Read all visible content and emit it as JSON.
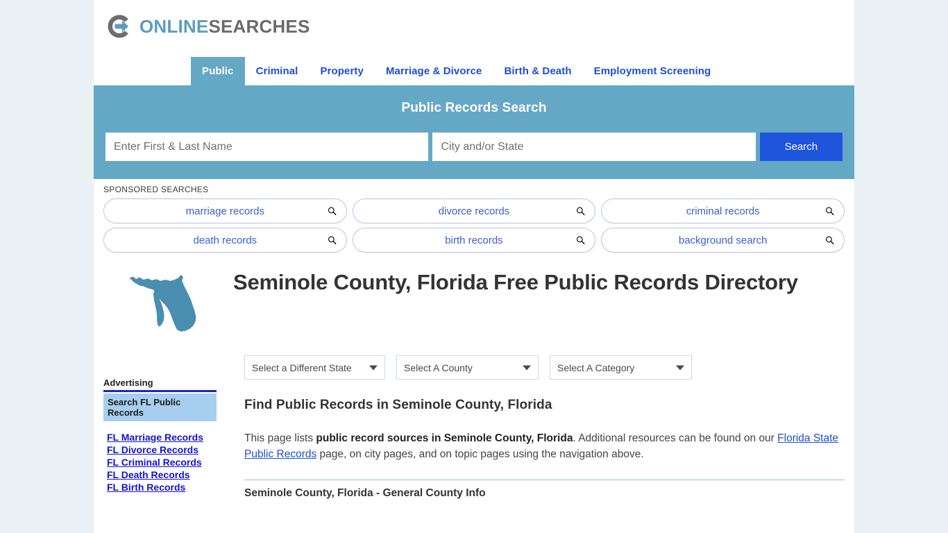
{
  "brand": {
    "name_part1": "ONLINE",
    "name_part2": "SEARCHES",
    "logo_icon": "circle-arrow-icon",
    "accent_blue": "#5a9dc0",
    "accent_gray": "#6b6b6b"
  },
  "nav": {
    "tabs": [
      {
        "label": "Public",
        "active": true
      },
      {
        "label": "Criminal",
        "active": false
      },
      {
        "label": "Property",
        "active": false
      },
      {
        "label": "Marriage & Divorce",
        "active": false
      },
      {
        "label": "Birth & Death",
        "active": false
      },
      {
        "label": "Employment Screening",
        "active": false
      }
    ]
  },
  "search": {
    "title": "Public Records Search",
    "name_placeholder": "Enter First & Last Name",
    "name_value": "",
    "city_placeholder": "City and/or State",
    "city_value": "",
    "button_label": "Search",
    "banner_color": "#65a8c5",
    "button_color": "#1f54dd"
  },
  "sponsored": {
    "label": "SPONSORED SEARCHES",
    "pills": [
      {
        "label": "marriage records",
        "icon": "search-icon"
      },
      {
        "label": "divorce records",
        "icon": "search-icon"
      },
      {
        "label": "criminal records",
        "icon": "search-icon"
      },
      {
        "label": "death records",
        "icon": "search-icon"
      },
      {
        "label": "birth records",
        "icon": "search-icon"
      },
      {
        "label": "background search",
        "icon": "search-icon"
      }
    ]
  },
  "hero": {
    "title": "Seminole County, Florida Free Public Records Directory",
    "map_icon": "florida-state-map-icon",
    "map_color": "#4a8fb0"
  },
  "filters": {
    "state": {
      "label": "Select a Different State"
    },
    "county": {
      "label": "Select A County"
    },
    "category": {
      "label": "Select A Category"
    }
  },
  "main": {
    "heading": "Find Public Records in Seminole County, Florida",
    "intro_part1": "This page lists ",
    "intro_bold": "public record sources in Seminole County, Florida",
    "intro_part2": ". Additional resources can be found on our ",
    "intro_link": "Florida State Public Records",
    "intro_part3": " page, on city pages, and on topic pages using the navigation above.",
    "table_first_row": "Seminole County, Florida - General County Info"
  },
  "sidebar": {
    "ad_title": "Advertising",
    "ad_cta": "Search FL Public Records",
    "links": [
      "FL Marriage Records",
      "FL Divorce Records",
      "FL Criminal Records",
      "FL Death Records",
      "FL Birth Records"
    ]
  }
}
